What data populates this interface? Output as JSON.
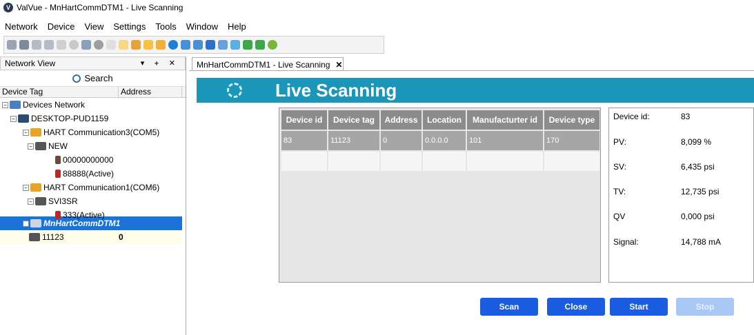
{
  "window": {
    "title": "ValVue - MnHartCommDTM1 - Live Scanning",
    "app_icon": "valvue-logo-icon"
  },
  "menu": [
    {
      "label": "Network"
    },
    {
      "label": "Device"
    },
    {
      "label": "View"
    },
    {
      "label": "Settings"
    },
    {
      "label": "Tools"
    },
    {
      "label": "Window"
    },
    {
      "label": "Help"
    }
  ],
  "toolbar": {
    "icons": [
      "connect-icon",
      "disconnect-icon",
      "device-icon",
      "device2-icon",
      "step-icon",
      "stop-icon",
      "search-icon",
      "eye-icon",
      "filter-icon",
      "f-icon",
      "arrow-icon",
      "folder-icon",
      "folder2-icon",
      "globe-icon",
      "monitor-icon",
      "monitor2-icon",
      "upload-icon",
      "download-icon",
      "export-icon",
      "import-icon",
      "import2-icon",
      "check-icon"
    ]
  },
  "network_view": {
    "title": "Network View",
    "controls": "▾ ᚐ ✕",
    "search_label": "Search",
    "col_device_tag": "Device Tag",
    "col_address": "Address",
    "tree": [
      {
        "label": "Devices Network"
      },
      {
        "label": "DESKTOP-PUD1159"
      },
      {
        "label": "HART Communication3(COM5)"
      },
      {
        "label": "NEW"
      },
      {
        "label": "00000000000"
      },
      {
        "label": "88888(Active)"
      },
      {
        "label": "HART Communication1(COM6)"
      },
      {
        "label": "SVI3SR"
      },
      {
        "label": "333(Active)"
      },
      {
        "label": "MnHartCommDTM1"
      },
      {
        "label": "11123",
        "address": "0"
      }
    ]
  },
  "doc_tab": {
    "label": "MnHartCommDTM1 - Live Scanning",
    "close": "✕"
  },
  "banner": {
    "title": "Live Scanning"
  },
  "table": {
    "headers": [
      "Device id",
      "Device tag",
      "Address",
      "Location",
      "Manufacturter id",
      "Device type"
    ],
    "rows": [
      [
        "83",
        "11123",
        "0",
        "0.0.0.0",
        "101",
        "170"
      ]
    ]
  },
  "details": [
    {
      "label": "Device id:",
      "value": "83"
    },
    {
      "label": "PV:",
      "value": "8,099 %"
    },
    {
      "label": "SV:",
      "value": "6,435 psi"
    },
    {
      "label": "TV:",
      "value": "12,735 psi"
    },
    {
      "label": "QV",
      "value": "0,000 psi"
    },
    {
      "label": "Signal:",
      "value": "14,788 mA"
    }
  ],
  "buttons": {
    "scan": "Scan",
    "close": "Close",
    "start": "Start",
    "stop": "Stop"
  }
}
